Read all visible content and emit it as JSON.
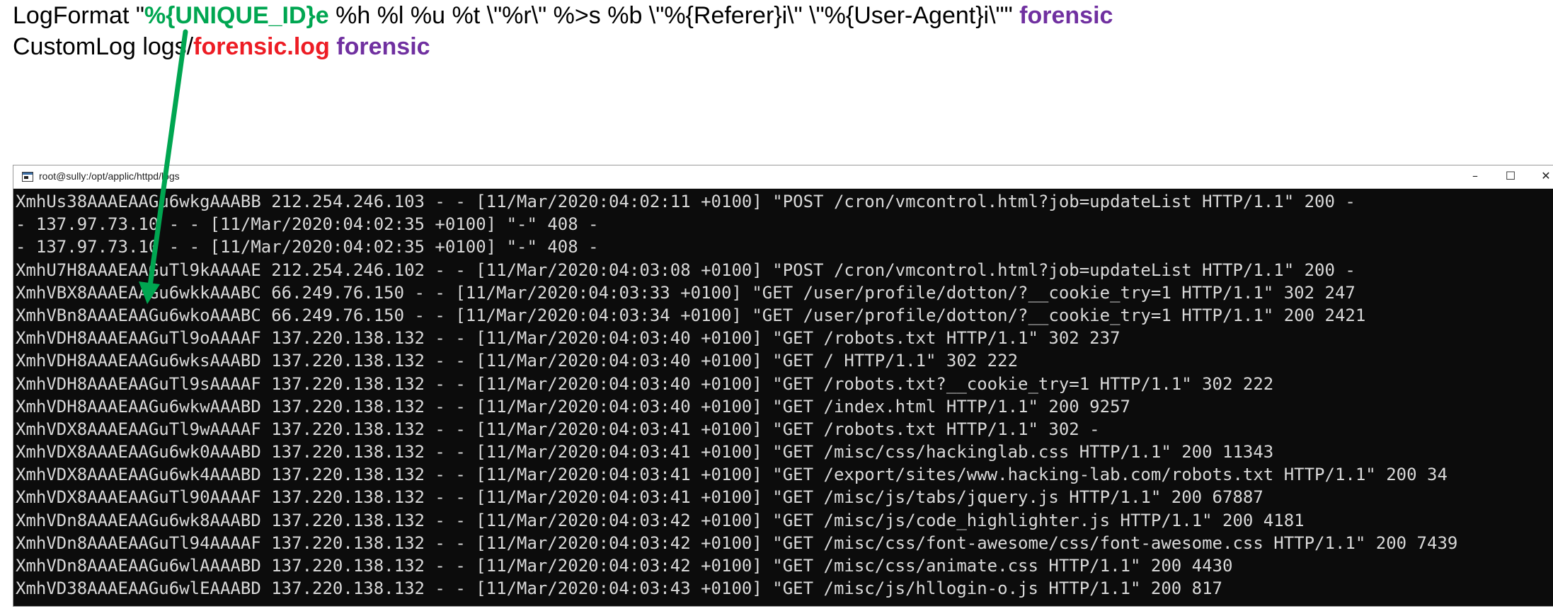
{
  "annotation": {
    "line1": {
      "prefix": "LogFormat \"",
      "unique_id": "%{UNIQUE_ID}e",
      "format_rest": " %h %l %u %t \\\"%r\\\" %>s %b \\\"%{Referer}i\\\" \\\"%{User-Agent}i\\\"\" ",
      "nickname": "forensic"
    },
    "line2": {
      "prefix": "CustomLog logs/",
      "filename": "forensic.log",
      "spacer": " ",
      "nickname": "forensic"
    },
    "colors": {
      "unique_id": "#00a651",
      "filename": "#ed1c24",
      "nickname": "#7030a0",
      "arrow": "#00a651"
    }
  },
  "terminal": {
    "title": "root@sully:/opt/applic/httpd/logs",
    "icon": "terminal-app-icon",
    "buttons": {
      "minimize": "–",
      "maximize": "☐",
      "close": "✕"
    },
    "lines": [
      "XmhUs38AAAEAAGu6wkgAAABB 212.254.246.103 - - [11/Mar/2020:04:02:11 +0100] \"POST /cron/vmcontrol.html?job=updateList HTTP/1.1\" 200 -",
      "- 137.97.73.10 - - [11/Mar/2020:04:02:35 +0100] \"-\" 408 -",
      "- 137.97.73.10 - - [11/Mar/2020:04:02:35 +0100] \"-\" 408 -",
      "XmhU7H8AAAEAAGuTl9kAAAAE 212.254.246.102 - - [11/Mar/2020:04:03:08 +0100] \"POST /cron/vmcontrol.html?job=updateList HTTP/1.1\" 200 -",
      "XmhVBX8AAAEAAGu6wkkAAABC 66.249.76.150 - - [11/Mar/2020:04:03:33 +0100] \"GET /user/profile/dotton/?__cookie_try=1 HTTP/1.1\" 302 247",
      "XmhVBn8AAAEAAGu6wkoAAABC 66.249.76.150 - - [11/Mar/2020:04:03:34 +0100] \"GET /user/profile/dotton/?__cookie_try=1 HTTP/1.1\" 200 2421",
      "XmhVDH8AAAEAAGuTl9oAAAAF 137.220.138.132 - - [11/Mar/2020:04:03:40 +0100] \"GET /robots.txt HTTP/1.1\" 302 237",
      "XmhVDH8AAAEAAGu6wksAAABD 137.220.138.132 - - [11/Mar/2020:04:03:40 +0100] \"GET / HTTP/1.1\" 302 222",
      "XmhVDH8AAAEAAGuTl9sAAAAF 137.220.138.132 - - [11/Mar/2020:04:03:40 +0100] \"GET /robots.txt?__cookie_try=1 HTTP/1.1\" 302 222",
      "XmhVDH8AAAEAAGu6wkwAAABD 137.220.138.132 - - [11/Mar/2020:04:03:40 +0100] \"GET /index.html HTTP/1.1\" 200 9257",
      "XmhVDX8AAAEAAGuTl9wAAAAF 137.220.138.132 - - [11/Mar/2020:04:03:41 +0100] \"GET /robots.txt HTTP/1.1\" 302 -",
      "XmhVDX8AAAEAAGu6wk0AAABD 137.220.138.132 - - [11/Mar/2020:04:03:41 +0100] \"GET /misc/css/hackinglab.css HTTP/1.1\" 200 11343",
      "XmhVDX8AAAEAAGu6wk4AAABD 137.220.138.132 - - [11/Mar/2020:04:03:41 +0100] \"GET /export/sites/www.hacking-lab.com/robots.txt HTTP/1.1\" 200 34",
      "XmhVDX8AAAEAAGuTl90AAAAF 137.220.138.132 - - [11/Mar/2020:04:03:41 +0100] \"GET /misc/js/tabs/jquery.js HTTP/1.1\" 200 67887",
      "XmhVDn8AAAEAAGu6wk8AAABD 137.220.138.132 - - [11/Mar/2020:04:03:42 +0100] \"GET /misc/js/code_highlighter.js HTTP/1.1\" 200 4181",
      "XmhVDn8AAAEAAGuTl94AAAAF 137.220.138.132 - - [11/Mar/2020:04:03:42 +0100] \"GET /misc/css/font-awesome/css/font-awesome.css HTTP/1.1\" 200 7439",
      "XmhVDn8AAAEAAGu6wlAAAABD 137.220.138.132 - - [11/Mar/2020:04:03:42 +0100] \"GET /misc/css/animate.css HTTP/1.1\" 200 4430",
      "XmhVD38AAAEAAGu6wlEAAABD 137.220.138.132 - - [11/Mar/2020:04:03:43 +0100] \"GET /misc/js/hllogin-o.js HTTP/1.1\" 200 817"
    ]
  }
}
